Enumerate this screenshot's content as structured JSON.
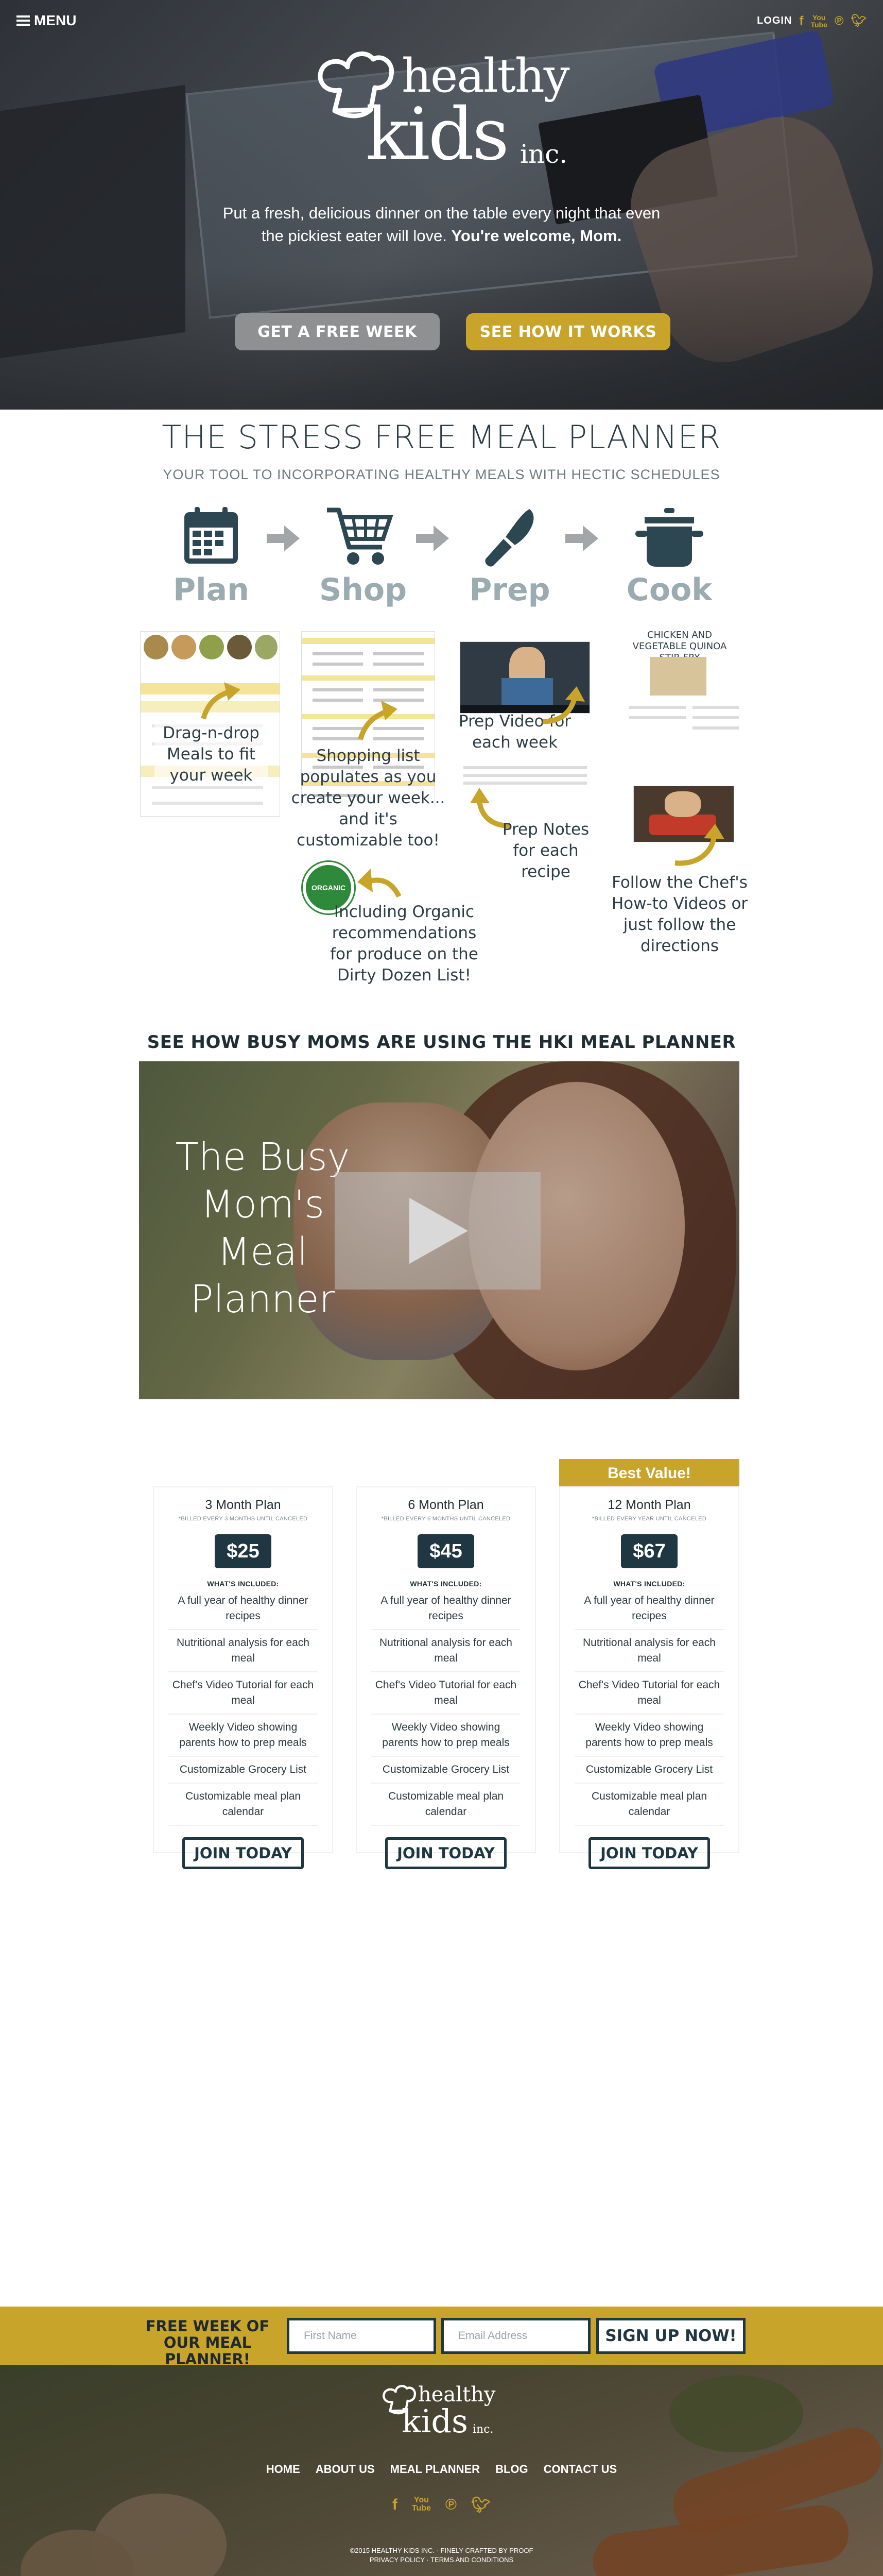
{
  "nav": {
    "menu_label": "MENU",
    "login_label": "LOGIN",
    "social_icons": [
      "facebook-icon",
      "youtube-icon",
      "pinterest-icon",
      "twitter-icon"
    ]
  },
  "hero": {
    "logo_line1": "healthy",
    "logo_line2": "kids",
    "logo_line3": "inc.",
    "tagline_text": "Put a fresh, delicious dinner on the table every night that even the pickiest eater will love.",
    "tagline_bold": "You're welcome, Mom.",
    "btn_free_week": "GET A FREE WEEK",
    "btn_how": "SEE HOW IT WORKS"
  },
  "meal_planner": {
    "title": "THE STRESS FREE MEAL PLANNER",
    "subtitle": "YOUR TOOL TO INCORPORATING HEALTHY MEALS WITH HECTIC SCHEDULES",
    "steps": [
      {
        "label": "Plan",
        "icon": "calendar-icon"
      },
      {
        "label": "Shop",
        "icon": "shopping-cart-icon"
      },
      {
        "label": "Prep",
        "icon": "knife-icon"
      },
      {
        "label": "Cook",
        "icon": "pot-icon"
      }
    ],
    "annotations": {
      "plan": "Drag-n-drop Meals to fit your week",
      "shop": "Shopping list populates as you create your week... and it's customizable too!",
      "organic": "Including Organic recommendations for produce on the Dirty Dozen List!",
      "organic_badge": "ORGANIC",
      "prep_video": "Prep Video for each week",
      "prep_notes": "Prep Notes for each recipe",
      "cook": "Follow the Chef's How-to Videos or just follow the directions",
      "recipe_title": "CHICKEN AND VEGETABLE QUINOA STIR-FRY"
    }
  },
  "video": {
    "heading": "SEE HOW BUSY MOMS ARE USING THE HKI MEAL PLANNER",
    "overlay_text": "The Busy Mom's Meal Planner"
  },
  "pricing": {
    "best_value": "Best Value!",
    "included_label": "WHAT'S INCLUDED:",
    "join_label": "JOIN TODAY",
    "plans": [
      {
        "name": "3 Month Plan",
        "billed": "*BILLED EVERY 3 MONTHS UNTIL CANCELED",
        "price": "$25"
      },
      {
        "name": "6 Month Plan",
        "billed": "*BILLED EVERY 6 MONTHS UNTIL CANCELED",
        "price": "$45"
      },
      {
        "name": "12 Month Plan",
        "billed": "*BILLED EVERY YEAR UNTIL CANCELED",
        "price": "$67"
      }
    ],
    "features": [
      "A full year of healthy dinner recipes",
      "Nutritional analysis for each meal",
      "Chef's Video Tutorial for each meal",
      "Weekly Video showing parents how to prep meals",
      "Customizable Grocery List",
      "Customizable meal plan calendar"
    ]
  },
  "signup": {
    "label": "FREE WEEK OF OUR MEAL PLANNER!",
    "first_name_placeholder": "First Name",
    "email_placeholder": "Email Address",
    "button": "SIGN UP NOW!"
  },
  "footer": {
    "nav": [
      "HOME",
      "ABOUT US",
      "MEAL PLANNER",
      "BLOG",
      "CONTACT US"
    ],
    "copyright": "©2015 HEALTHY KIDS INC. · FINELY CRAFTED BY PROOF",
    "legal": "PRIVACY POLICY · TERMS AND CONDITIONS"
  },
  "colors": {
    "accent_gold": "#c8a42a",
    "dark_navy": "#1e3742",
    "heading_slate": "#2b3e46",
    "step_label_grey": "#9aabb2"
  }
}
